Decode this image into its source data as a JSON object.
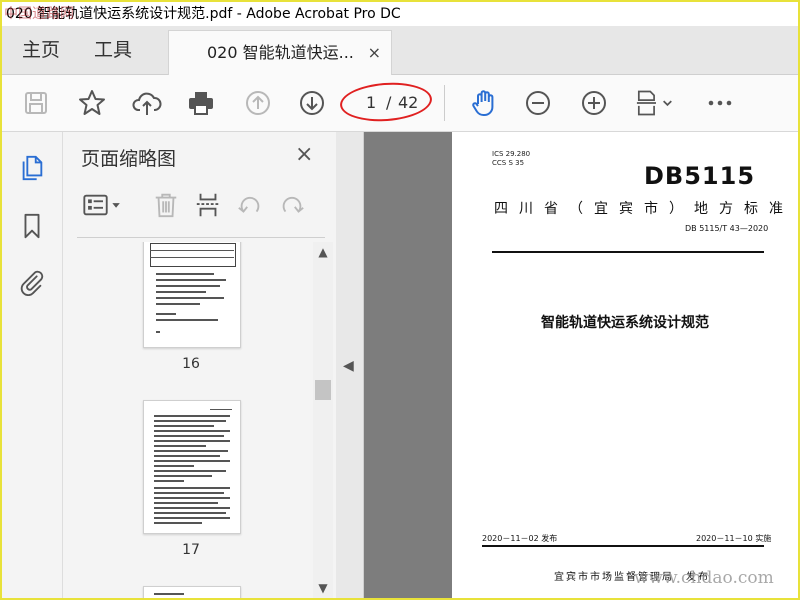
{
  "window": {
    "title": "020 智能轨道快运系统设计规范.pdf - Adobe Acrobat Pro DC",
    "watermark_top": "中国道路网"
  },
  "tabs": {
    "home": "主页",
    "tools": "工具",
    "document": "020 智能轨道快运...",
    "close": "×"
  },
  "toolbar": {
    "icons": [
      "save-icon",
      "star-icon",
      "upload-icon",
      "print-icon",
      "previous-page-icon",
      "next-page-icon",
      "hand-icon",
      "zoom-out-icon",
      "zoom-in-icon",
      "fit-page-icon",
      "more-icon"
    ],
    "page_current": "1",
    "page_separator": "/",
    "page_total": "42",
    "annotation_color": "#e02020"
  },
  "thumbnail_panel": {
    "title": "页面缩略图",
    "close": "×",
    "pages": [
      "16",
      "17"
    ]
  },
  "document_page": {
    "ics": "ICS  29.280",
    "ccs": "CCS  S 35",
    "code": "DB5115",
    "standard_type": "四川省（宜宾市）地方标准",
    "number": "DB 5115/T 43—2020",
    "title": "智能轨道快运系统设计规范",
    "issue_date": "2020－11－02 发布",
    "effective_date": "2020－11－10 实施",
    "issuer": "宜宾市市场监督管理局　发布"
  },
  "watermark_bottom": "www.chdao.com",
  "colors": {
    "frame": "#e8e23a",
    "accent_blue": "#2a6ed3"
  }
}
